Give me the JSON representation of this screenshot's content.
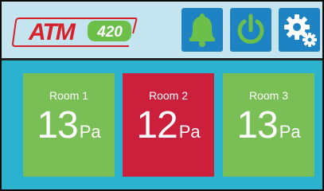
{
  "header": {
    "logo": {
      "brand": "ATM",
      "model": "420",
      "brand_color": "#d7202a",
      "model_color": "#6cc04a"
    },
    "buttons": [
      {
        "icon": "bell-icon",
        "color": "#6cc04a"
      },
      {
        "icon": "power-icon",
        "color": "#6cc04a"
      },
      {
        "icon": "gear-icon",
        "color": "#ffffff"
      }
    ],
    "background": "#c4e4ef",
    "button_color": "#1e83c3"
  },
  "rooms": [
    {
      "name": "Room 1",
      "value": "13",
      "unit": "Pa",
      "color": "#79bf55"
    },
    {
      "name": "Room 2",
      "value": "12",
      "unit": "Pa",
      "color": "#cb1f3b"
    },
    {
      "name": "Room 3",
      "value": "13",
      "unit": "Pa",
      "color": "#79bf55"
    }
  ],
  "background": "#2bb2cf"
}
